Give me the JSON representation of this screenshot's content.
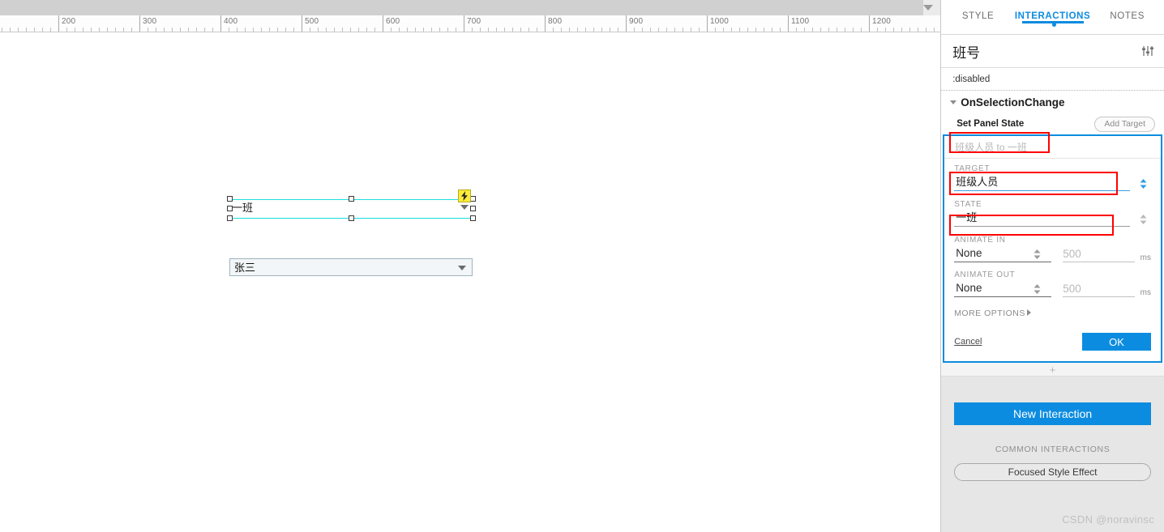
{
  "canvas": {
    "ruler": {
      "labels": [
        200,
        300,
        400,
        500,
        600,
        700,
        800,
        900,
        1000,
        1100,
        1200
      ],
      "scroll_caret_icon": "chevron-down-icon"
    },
    "selected_widget": {
      "text": "一班",
      "badge_icon": "lightning-bolt-icon",
      "caret_icon": "caret-down-icon"
    },
    "dropdown_widget": {
      "value": "张三",
      "caret_icon": "caret-down-icon"
    }
  },
  "panel": {
    "tabs": [
      {
        "label": "STYLE",
        "active": false,
        "dot": false
      },
      {
        "label": "INTERACTIONS",
        "active": true,
        "dot": true
      },
      {
        "label": "NOTES",
        "active": false,
        "dot": false
      }
    ],
    "header": {
      "title": "班号",
      "settings_icon": "sliders-icon"
    },
    "state_row": ":disabled",
    "event": {
      "label": "OnSelectionChange",
      "collapse_icon": "caret-down-icon"
    },
    "action": {
      "label": "Set Panel State",
      "add_target_label": "Add Target"
    },
    "editor": {
      "summary": "班级人员 to 一班",
      "target_label": "TARGET",
      "target_value": "班级人员",
      "state_label": "STATE",
      "state_value": "一班",
      "animate_in_label": "ANIMATE IN",
      "animate_in_value": "None",
      "animate_in_ms": "500",
      "animate_out_label": "ANIMATE OUT",
      "animate_out_value": "None",
      "animate_out_ms": "500",
      "ms_unit": "ms",
      "more_options_label": "MORE OPTIONS",
      "cancel_label": "Cancel",
      "ok_label": "OK",
      "spinner_icon": "spinner-updown-icon"
    },
    "add_row_icon": "plus-icon",
    "bottom": {
      "new_interaction_label": "New Interaction",
      "common_label": "COMMON INTERACTIONS",
      "focused_style_label": "Focused Style Effect"
    }
  },
  "watermark": "CSDN @noravinsc",
  "colors": {
    "accent_blue": "#0c8ce0",
    "annotation_red": "#ff0000",
    "selection_cyan": "#19dede",
    "badge_yellow": "#fbec3a"
  }
}
